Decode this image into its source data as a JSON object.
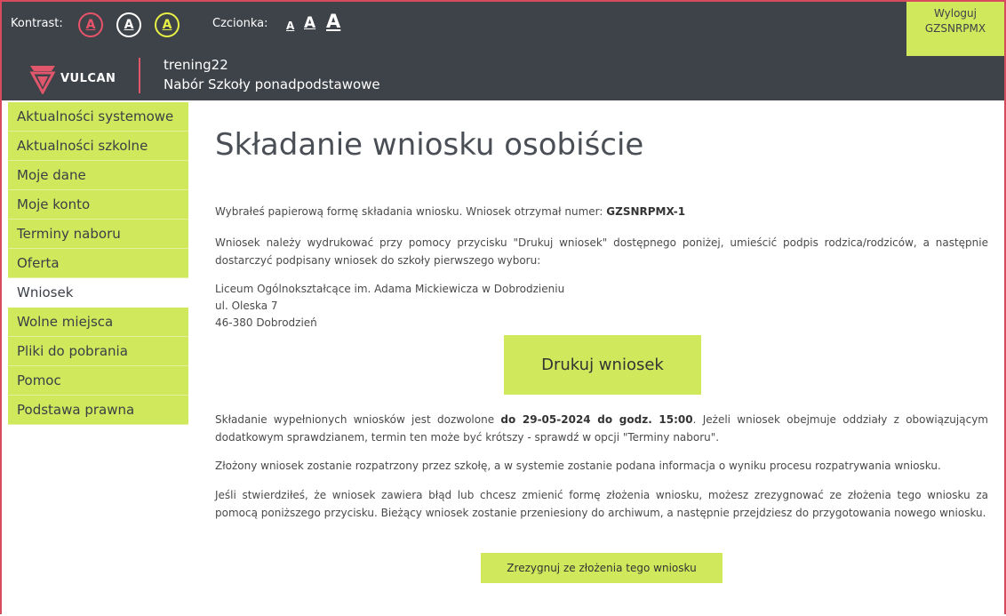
{
  "header": {
    "contrast_label": "Kontrast:",
    "contrast_buttons": [
      "A",
      "A",
      "A"
    ],
    "font_label": "Czcionka:",
    "font_sizes": [
      "A",
      "A",
      "A"
    ],
    "logout_line1": "Wyloguj",
    "logout_line2": "GZSNRPMX",
    "logo_text": "VULCAN",
    "app_line1": "trening22",
    "app_line2": "Nabór Szkoły ponadpodstawowe",
    "colors": {
      "bar": "#3e4249",
      "accent": "#d0e85c",
      "brand_red": "#e0566b"
    }
  },
  "sidebar": {
    "items": [
      {
        "label": "Aktualności systemowe"
      },
      {
        "label": "Aktualności szkolne"
      },
      {
        "label": "Moje dane"
      },
      {
        "label": "Moje konto"
      },
      {
        "label": "Terminy naboru"
      },
      {
        "label": "Oferta"
      },
      {
        "label": "Wniosek",
        "active": true
      },
      {
        "label": "Wolne miejsca"
      },
      {
        "label": "Pliki do pobrania"
      },
      {
        "label": "Pomoc"
      },
      {
        "label": "Podstawa prawna"
      }
    ]
  },
  "main": {
    "title": "Składanie wniosku osobiście",
    "p1_text": "Wybrałeś papierową formę składania wniosku. Wniosek otrzymał numer: ",
    "p1_number": "GZSNRPMX-1",
    "p2": "Wniosek należy wydrukować przy pomocy przycisku \"Drukuj wniosek\" dostępnego poniżej, umieścić podpis rodzica/rodziców, a następnie dostarczyć podpisany wniosek do szkoły pierwszego wyboru:",
    "address": {
      "line1": "Liceum Ogólnokształcące im. Adama Mickiewicza w Dobrodzieniu",
      "line2": "ul. Oleska 7",
      "line3": "46-380 Dobrodzień"
    },
    "print_button": "Drukuj wniosek",
    "p3_before": "Składanie wypełnionych wniosków jest dozwolone ",
    "p3_deadline": "do 29-05-2024 do godz. 15:00",
    "p3_after": ". Jeżeli wniosek obejmuje oddziały z obowiązującym dodatkowym sprawdzianem, termin ten może być krótszy - sprawdź w opcji \"Terminy naboru\".",
    "p4": "Złożony wniosek zostanie rozpatrzony przez szkołę, a w systemie zostanie podana informacja o wyniku procesu rozpatrywania wniosku.",
    "p5": "Jeśli stwierdziłeś, że wniosek zawiera błąd lub chcesz zmienić formę złożenia wniosku, możesz zrezygnować ze złożenia tego wniosku za pomocą poniższego przycisku. Bieżący wniosek zostanie przeniesiony do archiwum, a następnie przejdziesz do przygotowania nowego wniosku.",
    "resign_button": "Zrezygnuj ze złożenia tego wniosku"
  }
}
